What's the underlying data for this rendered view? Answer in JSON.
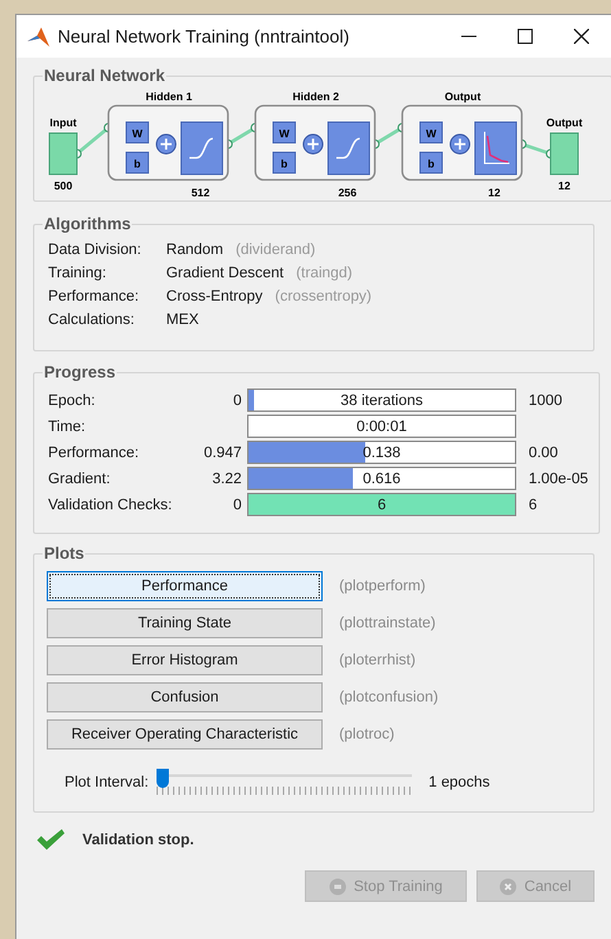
{
  "window": {
    "title": "Neural Network Training (nntraintool)"
  },
  "network": {
    "title": "Neural Network",
    "input": {
      "label": "Input",
      "size": "500"
    },
    "layers": [
      {
        "label": "Hidden 1",
        "size": "512",
        "weight": "W",
        "bias": "b",
        "kind": "sigmoid"
      },
      {
        "label": "Hidden 2",
        "size": "256",
        "weight": "W",
        "bias": "b",
        "kind": "sigmoid"
      },
      {
        "label": "Output",
        "size": "12",
        "weight": "W",
        "bias": "b",
        "kind": "softmax"
      }
    ],
    "output": {
      "label": "Output",
      "size": "12"
    }
  },
  "algorithms": {
    "title": "Algorithms",
    "rows": [
      {
        "label": "Data Division:",
        "value": "Random",
        "function": "(dividerand)"
      },
      {
        "label": "Training:",
        "value": "Gradient Descent",
        "function": "(traingd)"
      },
      {
        "label": "Performance:",
        "value": "Cross-Entropy",
        "function": "(crossentropy)"
      },
      {
        "label": "Calculations:",
        "value": "MEX"
      }
    ]
  },
  "progress": {
    "title": "Progress",
    "rows": [
      {
        "label": "Epoch:",
        "start": "0",
        "reading": "38 iterations",
        "end": "1000",
        "level": 0.02,
        "color": "#6b8de0"
      },
      {
        "label": "Time:",
        "reading": "0:00:01"
      },
      {
        "label": "Performance:",
        "start": "0.947",
        "reading": "0.138",
        "end": "0.00",
        "level": 0.44,
        "color": "#6b8de0"
      },
      {
        "label": "Gradient:",
        "start": "3.22",
        "reading": "0.616",
        "end": "1.00e-05",
        "level": 0.39,
        "color": "#6b8de0"
      },
      {
        "label": "Validation Checks:",
        "start": "0",
        "reading": "6",
        "end": "6",
        "level": 1,
        "color": "#72e2b4"
      }
    ]
  },
  "plots": {
    "title": "Plots",
    "buttons": [
      {
        "label": "Performance",
        "function": "(plotperform)",
        "selected": true
      },
      {
        "label": "Training State",
        "function": "(plottrainstate)",
        "selected": false
      },
      {
        "label": "Error Histogram",
        "function": "(ploterrhist)",
        "selected": false
      },
      {
        "label": "Confusion",
        "function": "(plotconfusion)",
        "selected": false
      },
      {
        "label": "Receiver Operating Characteristic",
        "function": "(plotroc)",
        "selected": false
      }
    ],
    "interval": {
      "label": "Plot Interval:",
      "level": 0,
      "reading": "1 epochs"
    }
  },
  "status": {
    "message": "Validation stop."
  },
  "buttons": [
    {
      "label": "Stop Training",
      "kind": "stop",
      "disabled": true
    },
    {
      "label": "Cancel",
      "kind": "cancel",
      "disabled": true
    }
  ]
}
